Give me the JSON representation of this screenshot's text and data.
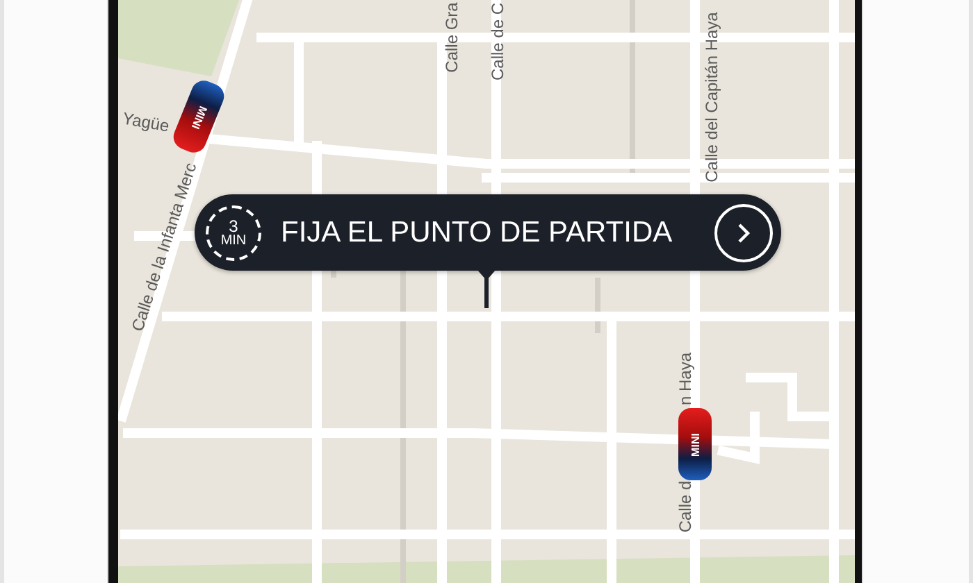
{
  "map": {
    "street_labels": [
      {
        "text": "Calle Gra"
      },
      {
        "text": "Calle de C"
      },
      {
        "text": "Calle del Capitán Haya"
      },
      {
        "text": "Yagüe"
      },
      {
        "text": "Calle de la Infanta Merc"
      },
      {
        "text": "Calle d"
      },
      {
        "text": "n Haya"
      }
    ],
    "cars": [
      {
        "label": "MINI"
      },
      {
        "label": "MINI"
      }
    ]
  },
  "pickup_prompt": {
    "eta_value": "3",
    "eta_unit": "MIN",
    "label": "FIJA EL PUNTO DE PARTIDA"
  }
}
